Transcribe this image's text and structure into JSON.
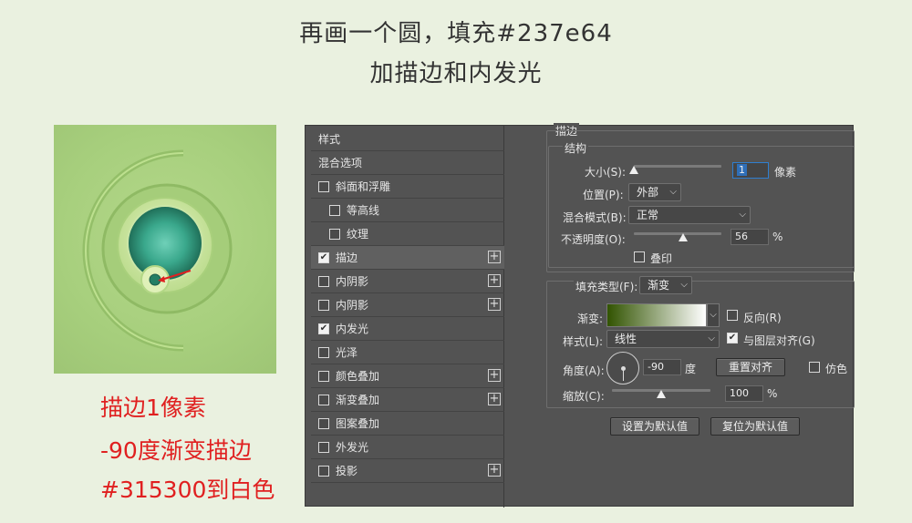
{
  "heading": {
    "line1": "再画一个圆，填充#237e64",
    "line2": "加描边和内发光"
  },
  "notes": {
    "line1": "描边1像素",
    "line2": "-90度渐变描边",
    "line3": "#315300到白色"
  },
  "colors": {
    "circle_fill": "#237e64",
    "gradient_start": "#315300",
    "gradient_end": "#ffffff",
    "annotation": "#e02020"
  },
  "layer_style": {
    "header": "样式",
    "items": [
      {
        "label": "混合选项",
        "checkbox": false,
        "has_checkbox": false,
        "plus": false,
        "active": false
      },
      {
        "label": "斜面和浮雕",
        "checkbox": false,
        "has_checkbox": true,
        "plus": false,
        "active": false
      },
      {
        "label": "等高线",
        "checkbox": false,
        "has_checkbox": true,
        "plus": false,
        "active": false,
        "indent": true
      },
      {
        "label": "纹理",
        "checkbox": false,
        "has_checkbox": true,
        "plus": false,
        "active": false,
        "indent": true
      },
      {
        "label": "描边",
        "checkbox": true,
        "has_checkbox": true,
        "plus": true,
        "active": true
      },
      {
        "label": "内阴影",
        "checkbox": false,
        "has_checkbox": true,
        "plus": true,
        "active": false
      },
      {
        "label": "内阴影",
        "checkbox": false,
        "has_checkbox": true,
        "plus": true,
        "active": false
      },
      {
        "label": "内发光",
        "checkbox": true,
        "has_checkbox": true,
        "plus": false,
        "active": false
      },
      {
        "label": "光泽",
        "checkbox": false,
        "has_checkbox": true,
        "plus": false,
        "active": false
      },
      {
        "label": "颜色叠加",
        "checkbox": false,
        "has_checkbox": true,
        "plus": true,
        "active": false
      },
      {
        "label": "渐变叠加",
        "checkbox": false,
        "has_checkbox": true,
        "plus": true,
        "active": false
      },
      {
        "label": "图案叠加",
        "checkbox": false,
        "has_checkbox": true,
        "plus": false,
        "active": false
      },
      {
        "label": "外发光",
        "checkbox": false,
        "has_checkbox": true,
        "plus": false,
        "active": false
      },
      {
        "label": "投影",
        "checkbox": false,
        "has_checkbox": true,
        "plus": true,
        "active": false
      }
    ]
  },
  "stroke": {
    "section_title": "描边",
    "structure_title": "结构",
    "size_label": "大小(S):",
    "size_value": "1",
    "size_unit": "像素",
    "position_label": "位置(P):",
    "position_value": "外部",
    "blend_label": "混合模式(B):",
    "blend_value": "正常",
    "opacity_label": "不透明度(O):",
    "opacity_value": "56",
    "opacity_unit": "%",
    "overprint_label": "叠印",
    "fill_type_label": "填充类型(F):",
    "fill_type_value": "渐变",
    "gradient_label": "渐变:",
    "reverse_label": "反向(R)",
    "style_label": "样式(L):",
    "style_value": "线性",
    "align_label": "与图层对齐(G)",
    "angle_label": "角度(A):",
    "angle_value": "-90",
    "angle_unit": "度",
    "reset_align_label": "重置对齐",
    "dither_label": "仿色",
    "scale_label": "缩放(C):",
    "scale_value": "100",
    "scale_unit": "%",
    "set_default_label": "设置为默认值",
    "reset_default_label": "复位为默认值",
    "slider_size": 0.0,
    "slider_opacity": 0.56,
    "slider_scale": 0.5
  }
}
